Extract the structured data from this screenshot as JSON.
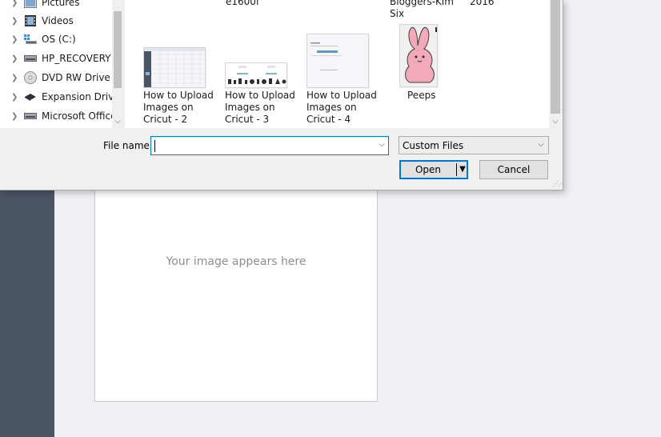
{
  "background": {
    "placeholder_text": "Your image appears here"
  },
  "dialog": {
    "nav_items": [
      {
        "label": "Pictures",
        "icon": "pictures-folder-icon"
      },
      {
        "label": "Videos",
        "icon": "videos-folder-icon"
      },
      {
        "label": "OS (C:)",
        "icon": "windows-drive-icon"
      },
      {
        "label": "HP_RECOVERY (",
        "icon": "hard-drive-icon"
      },
      {
        "label": "DVD RW Drive (E",
        "icon": "dvd-drive-icon"
      },
      {
        "label": "Expansion Drive",
        "icon": "external-drive-icon"
      },
      {
        "label": "Microsoft Office",
        "icon": "drive-icon"
      }
    ],
    "partial_labels": {
      "item_a": "e1600f",
      "item_b_line1": "Bloggers-Kim",
      "item_b_line2": "Six",
      "item_c": "2016"
    },
    "files": [
      {
        "name": "How to Upload Images on Cricut - 2",
        "thumb": "screenshot-grid"
      },
      {
        "name": "How to Upload Images on Cricut - 3",
        "thumb": "screenshot-shapes"
      },
      {
        "name": "How to Upload Images on Cricut - 4",
        "thumb": "screenshot-form"
      },
      {
        "name": "Peeps",
        "thumb": "pink-bunny-image"
      }
    ],
    "file_name_label": "File name:",
    "file_name_value": "",
    "file_type_filter": "Custom Files",
    "open_label": "Open",
    "cancel_label": "Cancel"
  },
  "colors": {
    "sidebar_bg": "#4b5465",
    "accent": "#0078d7",
    "bunny_pink": "#f2a9b8"
  }
}
